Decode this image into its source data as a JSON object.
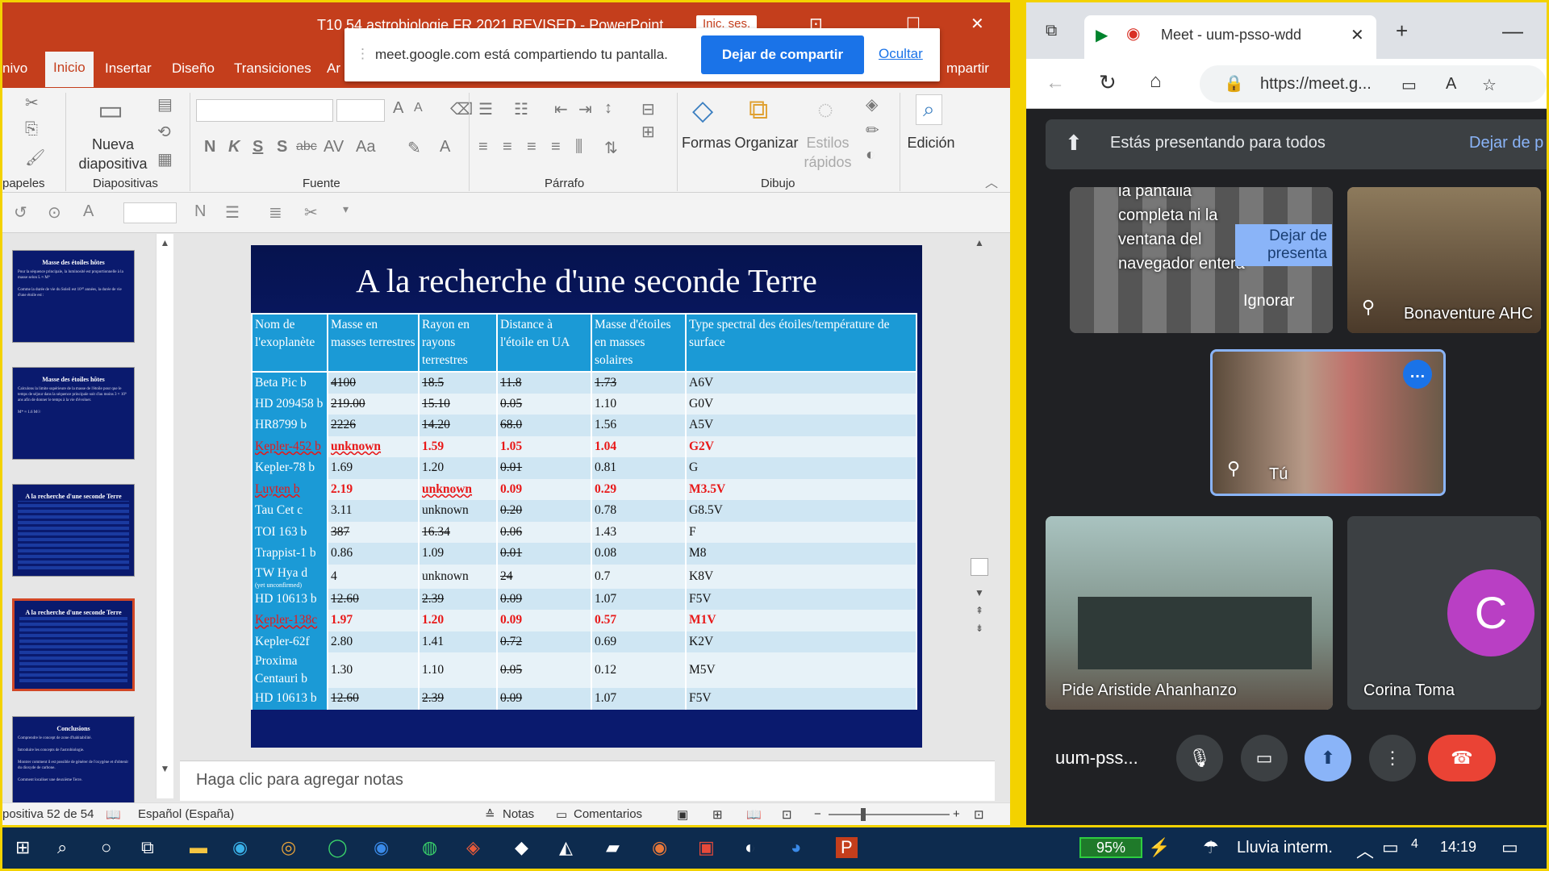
{
  "ppt": {
    "title": "T10 54 astrobiologie FR 2021 REVISED - PowerPoint",
    "signin": "Inic. ses.",
    "tabs": [
      "nivo",
      "Inicio",
      "Insertar",
      "Diseño",
      "Transiciones",
      "Ar",
      "mpartir"
    ],
    "ribbon": {
      "new_slide": "Nueva diapositiva",
      "shapes": "Formas",
      "arrange": "Organizar",
      "quick_styles": "Estilos rápidos",
      "editing": "Edición",
      "groups": [
        "papeles",
        "Diapositivas",
        "Fuente",
        "Párrafo",
        "Dibujo"
      ],
      "font_btns": [
        "N",
        "K",
        "S",
        "S",
        "abc",
        "AV",
        "Aa",
        "A"
      ]
    },
    "notes_placeholder": "Haga clic para agregar notas",
    "status": {
      "slide": "positiva 52 de 54",
      "language": "Español (España)",
      "notes": "Notas",
      "comments": "Comentarios"
    },
    "thumbs": [
      {
        "title": "Masse des étoiles hôtes",
        "lines": [
          "Pour la séquence principale, la luminosité est proportionnelle à la masse selon L ≈ M⁴",
          "Comme la durée de vie du Soleil est 10¹⁰ années, la durée de vie d'une étoile est :"
        ]
      },
      {
        "title": "Masse des étoiles hôtes",
        "lines": [
          "Calculons la limite supérieure de la masse de l'étoile pour que le temps de séjour dans la séquence principale soit d'au moins 3 × 10⁹ ans afin de donner le temps à la vie d'évoluer.",
          "M* ≈ 1.6 M☉"
        ]
      },
      {
        "title": "A la recherche d'une seconde Terre",
        "lines": []
      },
      {
        "title": "A la recherche d'une seconde Terre",
        "lines": []
      },
      {
        "title": "Conclusions",
        "lines": [
          "Comprendre le concept de zone d'habitabilité.",
          "Introduire les concepts de l'astrobiologie.",
          "Montrer comment il est possible de générer de l'oxygène et d'obtenir du dioxyde de carbone.",
          "Comment localiser une deuxième Terre."
        ]
      }
    ]
  },
  "share": {
    "message": "meet.google.com está compartiendo tu pantalla.",
    "stop": "Dejar de compartir",
    "hide": "Ocultar"
  },
  "slide": {
    "title": "A la recherche d'une seconde Terre",
    "headers": [
      "Nom de l'exoplanète",
      "Masse en masses terrestres",
      "Rayon en rayons terrestres",
      "Distance à l'étoile en UA",
      "Masse d'étoiles en masses solaires",
      "Type spectral des étoiles/température de surface"
    ],
    "rows": [
      {
        "n": "Beta Pic b",
        "m": "4100",
        "r": "18.5",
        "d": "11.8",
        "s": "1.73",
        "t": "A6V"
      },
      {
        "n": "HD 209458 b",
        "m": "219.00",
        "r": "15.10",
        "d": "0.05",
        "s": "1.10",
        "t": "G0V"
      },
      {
        "n": "HR8799 b",
        "m": "2226",
        "r": "14.20",
        "d": "68.0",
        "s": "1.56",
        "t": "A5V"
      },
      {
        "n": "Kepler-452 b",
        "m": "unknown",
        "r": "1.59",
        "d": "1.05",
        "s": "1.04",
        "t": "G2V",
        "red": true
      },
      {
        "n": "Kepler-78 b",
        "m": "1.69",
        "r": "1.20",
        "d": "0.01",
        "s": "0.81",
        "t": "G"
      },
      {
        "n": "Luyten b",
        "m": "2.19",
        "r": "unknown",
        "d": "0.09",
        "s": "0.29",
        "t": "M3.5V",
        "red": true
      },
      {
        "n": "Tau Cet c",
        "m": "3.11",
        "r": "unknown",
        "d": "0.20",
        "s": "0.78",
        "t": "G8.5V"
      },
      {
        "n": "TOI 163 b",
        "m": "387",
        "r": "16.34",
        "d": "0.06",
        "s": "1.43",
        "t": "F"
      },
      {
        "n": "Trappist-1 b",
        "m": "0.86",
        "r": "1.09",
        "d": "0.01",
        "s": "0.08",
        "t": "M8"
      },
      {
        "n": "TW Hya d",
        "sub": "(yet unconfirmed)",
        "m": "4",
        "r": "unknown",
        "d": "24",
        "s": "0.7",
        "t": "K8V"
      },
      {
        "n": "HD 10613 b",
        "m": "12.60",
        "r": "2.39",
        "d": "0.09",
        "s": "1.07",
        "t": "F5V"
      },
      {
        "n": "Kepler-138c",
        "m": "1.97",
        "r": "1.20",
        "d": "0.09",
        "s": "0.57",
        "t": "M1V",
        "red": true
      },
      {
        "n": "Kepler-62f",
        "m": "2.80",
        "r": "1.41",
        "d": "0.72",
        "s": "0.69",
        "t": "K2V"
      },
      {
        "n": "Proxima Centauri b",
        "m": "1.30",
        "r": "1.10",
        "d": "0.05",
        "s": "0.12",
        "t": "M5V"
      },
      {
        "n": "HD 10613 b",
        "m": "12.60",
        "r": "2.39",
        "d": "0.09",
        "s": "1.07",
        "t": "F5V"
      }
    ]
  },
  "browser": {
    "tab_title": "Meet - uum-psso-wdd",
    "url": "https://meet.g...",
    "presenting": "Estás presentando para todos",
    "stop_present": "Dejar de p",
    "tiles": {
      "screen_lines": "la pantalla completa ni la ventana del navegador entera",
      "stop_presenting": "Dejar de presenta",
      "ignore": "Ignorar",
      "p1": "Bonaventure AHC",
      "me": "Tú",
      "p2": "Pide Aristide Ahanhanzo",
      "p3": "Corina Toma",
      "p3_initial": "C"
    },
    "meeting_code": "uum-pss..."
  },
  "taskbar": {
    "battery": "95%",
    "weather": "Lluvia interm.",
    "time": "14:19",
    "notif": "4"
  }
}
